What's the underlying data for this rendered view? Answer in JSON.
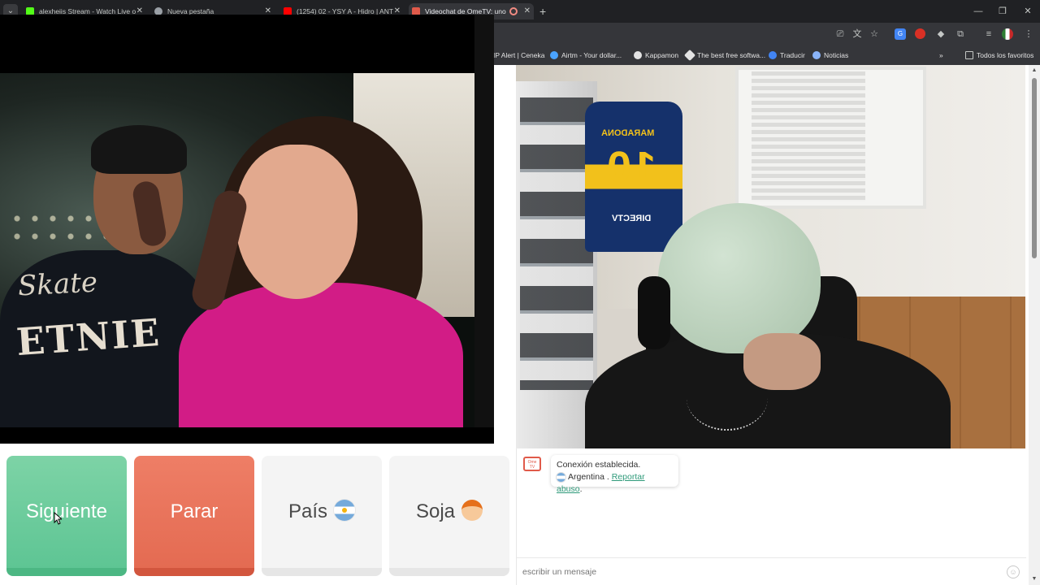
{
  "browser": {
    "tabs": [
      {
        "title": "alexheiis Stream - Watch Live o",
        "favicon_color": "#53fc18"
      },
      {
        "title": "Nueva pestaña",
        "favicon_color": "#9aa0a6"
      },
      {
        "title": "(1254) 02 - YSY A - Hidro | ANT",
        "favicon_color": "#ff0000"
      },
      {
        "title": "Videochat de OmeTV: uno",
        "favicon_color": "#e05a4a",
        "active": true
      }
    ],
    "bookmarks": [
      {
        "label": "IP Alert | Ceneka",
        "icon_color": "#4285f4"
      },
      {
        "label": "Airtm - Your dollar...",
        "icon_color": "#4aa3ff"
      },
      {
        "label": "Kappamon",
        "icon_color": "#e3e3e3"
      },
      {
        "label": "The best free softwa...",
        "icon_color": "#e3e3e3"
      },
      {
        "label": "Traducir",
        "icon_color": "#4285f4"
      },
      {
        "label": "Noticias",
        "icon_color": "#8ab4f8"
      }
    ],
    "bookmarks_more": "»",
    "all_bookmarks": "Todos los favoritos",
    "toolbar_icons": [
      "cast-icon",
      "translate-icon",
      "star-icon",
      "extension-translate-icon",
      "extension-red-icon",
      "extension-diamond-icon",
      "puzzle-icon",
      "media-icon",
      "profile-icon",
      "menu-icon"
    ]
  },
  "controls": {
    "next_label": "Siguiente",
    "stop_label": "Parar",
    "country_label": "País",
    "gender_label": "Soja"
  },
  "video": {
    "jersey_name": "MARADONA",
    "jersey_number": "10",
    "jersey_sponsor": "DIRECTV",
    "shirt_text_top": "Skate",
    "shirt_text_bottom": "ETNIE"
  },
  "chat": {
    "logo_text": "Ome TV",
    "status": "Conexión establecida.",
    "country": "Argentina",
    "separator": " . ",
    "report_link": "Reportar abuso",
    "report_suffix": ".",
    "input_placeholder": "escribir un mensaje"
  },
  "colors": {
    "next": "#6fcc9d",
    "stop": "#ea7560",
    "neutral": "#f4f4f4",
    "link": "#2f9a7a"
  }
}
